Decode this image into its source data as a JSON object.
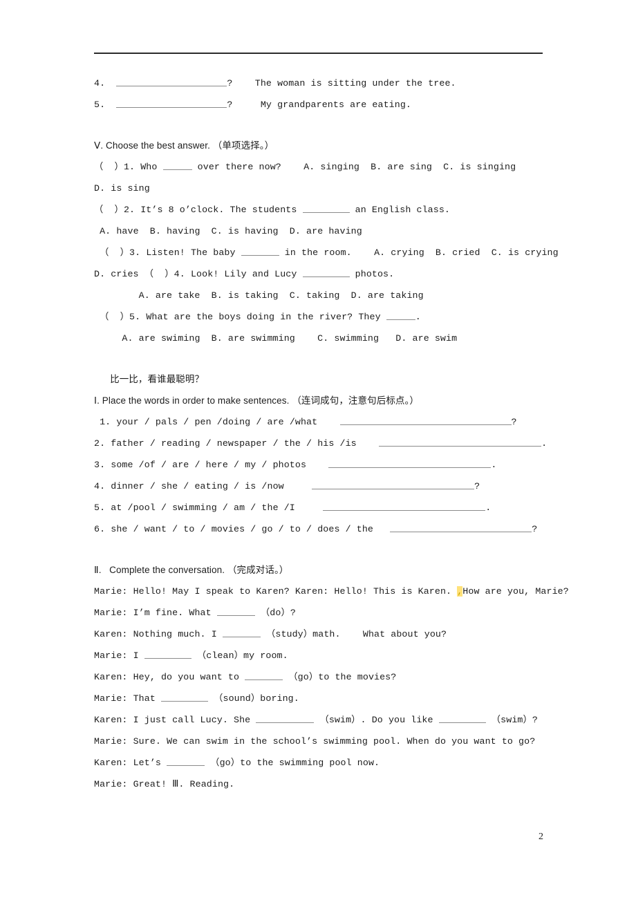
{
  "document": {
    "page_number": "2",
    "header_rule": true
  },
  "section_iv_tail": {
    "items": [
      {
        "num": "4.",
        "blank": "____________________",
        "q": "?",
        "answer": "The woman is sitting under the tree."
      },
      {
        "num": "5.",
        "blank": "____________________",
        "q": "?",
        "answer": "My grandparents are eating."
      }
    ]
  },
  "section_v": {
    "heading": "Ⅴ. Choose the best answer. （单项选择。）",
    "questions": [
      {
        "marker": "（  ）1.",
        "stem_before": "Who",
        "stem_after": "over there now?",
        "options_line1": "A. singing  B. are sing  C. is singing",
        "options_line2": "D. is sing"
      },
      {
        "marker": "（  ）2.",
        "stem_before": "It’s 8 o’clock. The students",
        "stem_after": "an English class.",
        "options_line1": "A. have  B. having  C. is having  D. are having"
      },
      {
        "marker": "（  ）3.",
        "stem_before": "Listen! The baby",
        "stem_after": "in the room.",
        "options_line1": "A. crying  B. cried  C. is crying",
        "options_line2": "D. cries"
      },
      {
        "marker": "（  ）4.",
        "stem_before": "Look! Lily and Lucy",
        "stem_after": "photos.",
        "options_line1": "A. are take  B. is taking  C. taking  D. are taking"
      },
      {
        "marker": "（  ）5.",
        "stem_before": "What are the boys doing in the river? They",
        "stem_after": ".",
        "options_line1": "A. are swiming  B. are swimming    C. swimming   D. are swim"
      }
    ]
  },
  "compare_section": {
    "title": "比一比，看谁最聪明？",
    "part_i": {
      "heading": "Ⅰ. Place the words in order to make sentences. （连词成句，注意句后标点。）",
      "items": [
        {
          "num": "1.",
          "words": "your / pals / pen /doing / are /what",
          "end_punct": "?"
        },
        {
          "num": "2.",
          "words": "father / reading / newspaper / the / his /is",
          "end_punct": "."
        },
        {
          "num": "3.",
          "words": "some /of / are / here / my / photos",
          "end_punct": "."
        },
        {
          "num": "4.",
          "words": "dinner / she / eating / is /now",
          "end_punct": "?"
        },
        {
          "num": "5.",
          "words": "at /pool / swimming / am / the /I",
          "end_punct": "."
        },
        {
          "num": "6.",
          "words": "she / want / to / movies / go / to / does / the",
          "end_punct": "?"
        }
      ]
    },
    "part_ii": {
      "heading": "Ⅱ.   Complete the conversation. （完成对话。）",
      "lines": [
        {
          "speaker": "Marie:",
          "pre": "Hello! May I speak to Karen? Karen: Hello! This is Karen.",
          "hl": ",",
          "post": "How are you, Marie?",
          "has_blank": false
        },
        {
          "speaker": "Marie:",
          "pre": "I’m fine. What",
          "post": "（do）?",
          "has_blank": true
        },
        {
          "speaker": "Karen:",
          "pre": "Nothing much. I",
          "post": "（study）math.    What about you?",
          "has_blank": true
        },
        {
          "speaker": "Marie:",
          "pre": "I",
          "post": "（clean）my room.",
          "has_blank": true
        },
        {
          "speaker": "Karen:",
          "pre": "Hey, do you want to",
          "post": "（go）to the movies?",
          "has_blank": true
        },
        {
          "speaker": "Marie:",
          "pre": "That",
          "post": "（sound）boring.",
          "has_blank": true
        },
        {
          "speaker": "Karen:",
          "pre": "I just call Lucy. She",
          "mid": "（swim）. Do you like",
          "post": "（swim）?",
          "has_blank": true,
          "two_blanks": true
        },
        {
          "speaker": "Marie:",
          "pre": "Sure. We can swim in the school’s swimming pool. When do you want to go?",
          "has_blank": false
        },
        {
          "speaker": "Karen:",
          "pre": "Let’s",
          "post": "（go）to the swimming pool now.",
          "has_blank": true
        },
        {
          "speaker": "Marie:",
          "pre": "Great! Ⅲ. Reading.",
          "has_blank": false
        }
      ]
    }
  }
}
